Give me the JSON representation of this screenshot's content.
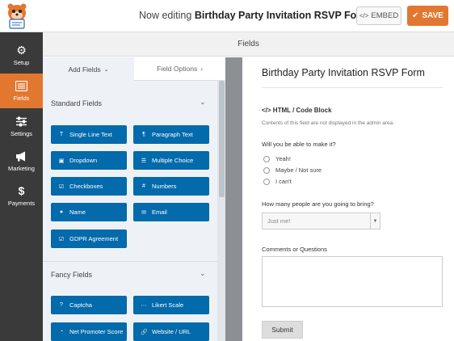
{
  "header": {
    "editing_prefix": "Now editing",
    "form_name": "Birthday Party Invitation RSVP Form",
    "embed_label": "EMBED",
    "save_label": "SAVE",
    "accent_color": "#e27730"
  },
  "sidebar": {
    "items": [
      {
        "label": "Setup",
        "icon": "gear-icon"
      },
      {
        "label": "Fields",
        "icon": "fields-list-icon"
      },
      {
        "label": "Settings",
        "icon": "sliders-icon"
      },
      {
        "label": "Marketing",
        "icon": "megaphone-icon"
      },
      {
        "label": "Payments",
        "icon": "dollar-icon"
      }
    ]
  },
  "section_header": "Fields",
  "panel": {
    "tab_add": "Add Fields",
    "tab_options": "Field Options",
    "standard_title": "Standard Fields",
    "standard_fields": [
      "Single Line Text",
      "Paragraph Text",
      "Dropdown",
      "Multiple Choice",
      "Checkboxes",
      "Numbers",
      "Name",
      "Email",
      "GDPR Agreement"
    ],
    "fancy_title": "Fancy Fields",
    "fancy_fields": [
      "Captcha",
      "Likert Scale",
      "Net Promoter Score",
      "Website / URL"
    ]
  },
  "preview": {
    "title": "Birthday Party Invitation RSVP Form",
    "html_block_label": "</> HTML / Code Block",
    "html_block_note": "Contents of this field are not displayed in the admin area.",
    "q1_label": "Will you be able to make it?",
    "q1_options": [
      "Yeah!",
      "Maybe / Not sure",
      "I can't"
    ],
    "q2_label": "How many people are you going to bring?",
    "q2_selected": "Just me!",
    "q3_label": "Comments or Questions",
    "submit_label": "Submit"
  }
}
